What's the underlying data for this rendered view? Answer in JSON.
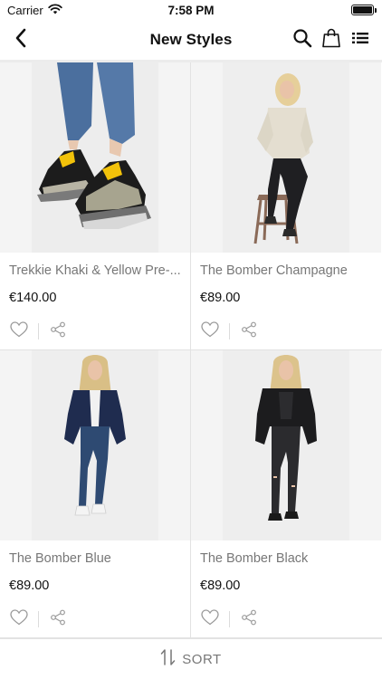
{
  "status_bar": {
    "carrier": "Carrier",
    "time": "7:58 PM"
  },
  "nav": {
    "title": "New Styles",
    "icons": [
      "back-icon",
      "search-icon",
      "shopping-bag-icon",
      "list-view-icon"
    ]
  },
  "products": [
    {
      "name": "Trekkie Khaki & Yellow Pre-...",
      "price": "€140.00",
      "image": "sneakers-photo"
    },
    {
      "name": "The Bomber Champagne",
      "price": "€89.00",
      "image": "model-champagne-bomber-photo"
    },
    {
      "name": "The Bomber Blue",
      "price": "€89.00",
      "image": "model-blue-bomber-photo"
    },
    {
      "name": "The Bomber Black",
      "price": "€89.00",
      "image": "model-black-bomber-photo"
    }
  ],
  "sort_bar": {
    "label": "SORT"
  },
  "colors": {
    "text_primary": "#111111",
    "text_secondary": "#777777",
    "divider": "#e2e2e2",
    "image_background": "#f4f4f4"
  }
}
